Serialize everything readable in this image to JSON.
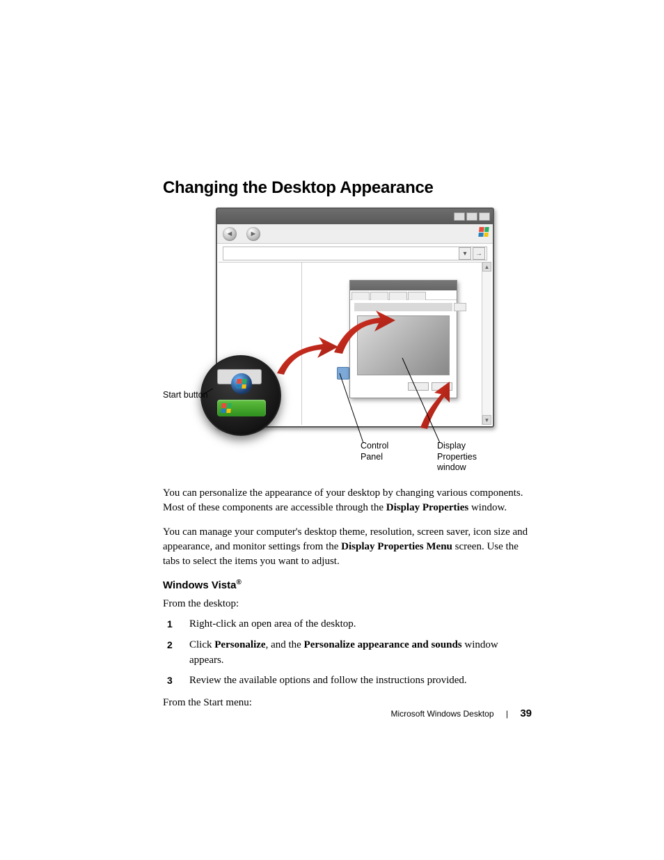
{
  "heading": "Changing the Desktop Appearance",
  "figure": {
    "labels": {
      "start_button": "Start button",
      "control_panel_l1": "Control",
      "control_panel_l2": "Panel",
      "display_props_l1": "Display",
      "display_props_l2": "Properties",
      "display_props_l3": "window"
    }
  },
  "para1": {
    "pre": "You can personalize the appearance of your desktop by changing various components. Most of these components are accessible through the ",
    "bold": "Display Properties",
    "post": " window."
  },
  "para2": {
    "pre": "You can manage your computer's desktop theme, resolution, screen saver, icon size and appearance, and monitor settings from the ",
    "bold": "Display Properties Menu",
    "post": " screen. Use the tabs to select the items you want to adjust."
  },
  "subheading": {
    "text": "Windows Vista",
    "mark": "®"
  },
  "lead1": "From the desktop:",
  "steps": [
    {
      "n": "1",
      "parts": [
        {
          "t": "Right-click an open area of the desktop."
        }
      ]
    },
    {
      "n": "2",
      "parts": [
        {
          "t": "Click "
        },
        {
          "b": "Personalize"
        },
        {
          "t": ", and the "
        },
        {
          "b": "Personalize appearance and sounds"
        },
        {
          "t": " window appears."
        }
      ]
    },
    {
      "n": "3",
      "parts": [
        {
          "t": "Review the available options and follow the instructions provided."
        }
      ]
    }
  ],
  "lead2": "From the Start menu:",
  "footer": {
    "section": "Microsoft Windows Desktop",
    "page": "39"
  }
}
